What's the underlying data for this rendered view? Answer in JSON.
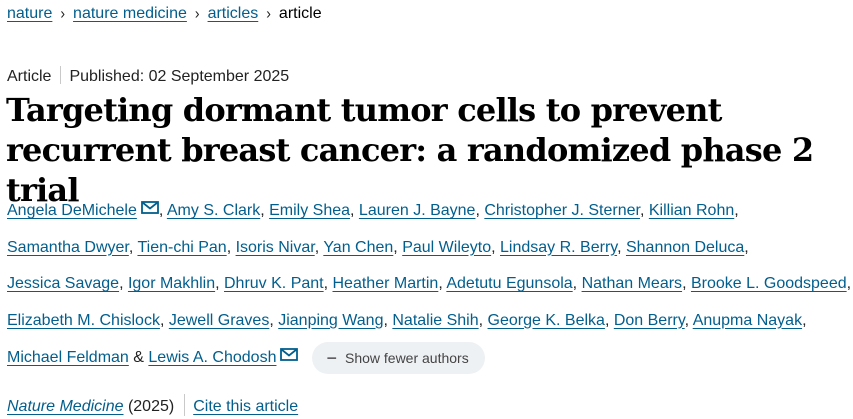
{
  "breadcrumb": {
    "items": [
      "nature",
      "nature medicine",
      "articles"
    ],
    "separator": "›",
    "current": "article"
  },
  "article": {
    "type": "Article",
    "published": "Published: 02 September 2025",
    "title": "Targeting dormant tumor cells to prevent recurrent breast cancer: a randomized phase 2 trial"
  },
  "authors": {
    "list": [
      "Angela DeMichele",
      "Amy S. Clark",
      "Emily Shea",
      "Lauren J. Bayne",
      "Christopher J. Sterner",
      "Killian Rohn",
      "Samantha Dwyer",
      "Tien-chi Pan",
      "Isoris Nivar",
      "Yan Chen",
      "Paul Wileyto",
      "Lindsay R. Berry",
      "Shannon Deluca",
      "Jessica Savage",
      "Igor Makhlin",
      "Dhruv K. Pant",
      "Heather Martin",
      "Adetutu Egunsola",
      "Nathan Mears",
      "Brooke L. Goodspeed",
      "Elizabeth M. Chislock",
      "Jewell Graves",
      "Jianping Wang",
      "Natalie Shih",
      "George K. Belka",
      "Don Berry",
      "Anupma Nayak",
      "Michael Feldman",
      "Lewis A. Chodosh"
    ],
    "separator": ", ",
    "final_separator": " & ",
    "show_fewer_label": "Show fewer authors",
    "icon": "minus-icon"
  },
  "journal": {
    "name": "Nature Medicine",
    "year": "(2025)",
    "cite_label": "Cite this article"
  },
  "colors": {
    "link": "#025e8d",
    "text": "#222222",
    "title": "#000000",
    "pill_bg": "#eef1f4"
  }
}
